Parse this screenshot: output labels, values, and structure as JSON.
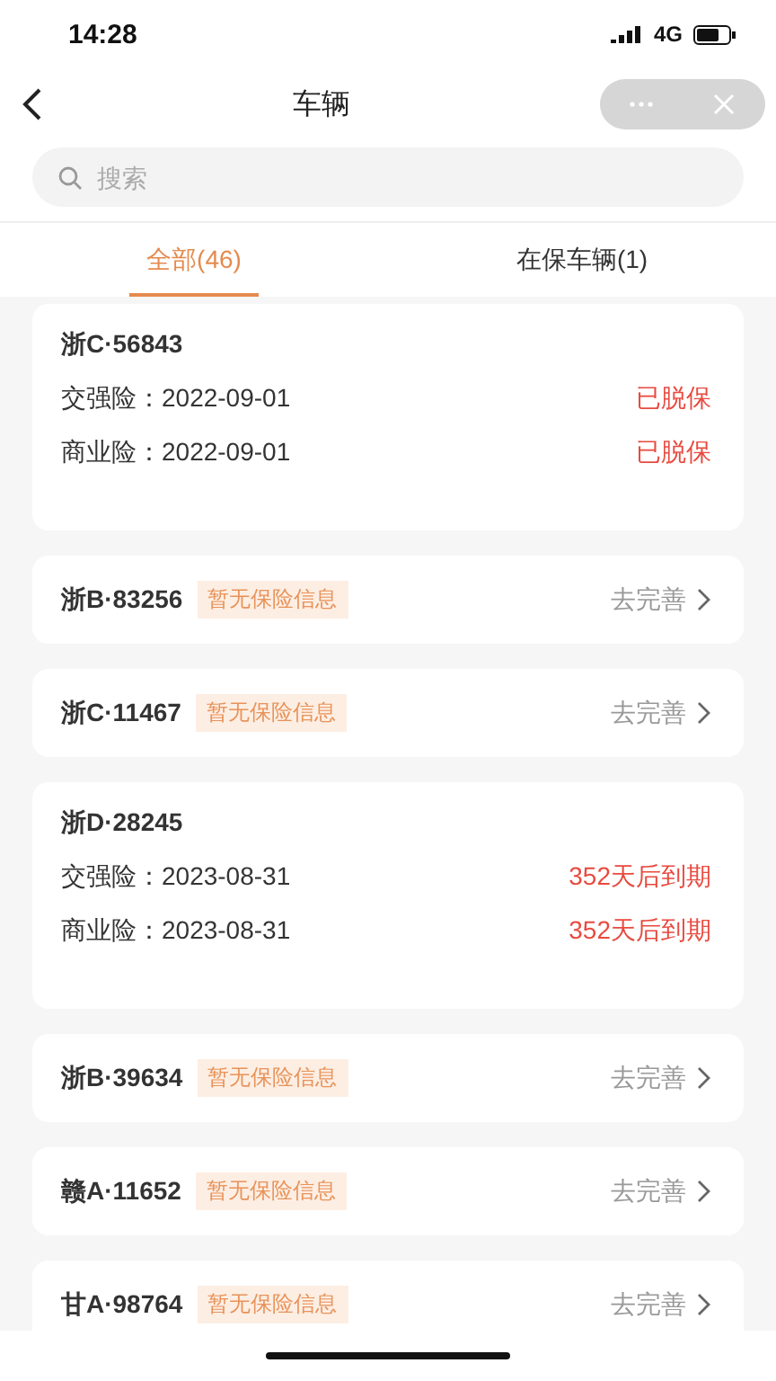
{
  "status_bar": {
    "time": "14:28",
    "network": "4G"
  },
  "nav": {
    "title": "车辆"
  },
  "search": {
    "placeholder": "搜索"
  },
  "tabs": [
    {
      "label": "全部(46)",
      "selected": true
    },
    {
      "label": "在保车辆(1)",
      "selected": false
    }
  ],
  "vehicles": [
    {
      "kind": "detail",
      "plate": "浙C·56843",
      "policies": [
        {
          "label": "交强险：2022-09-01",
          "status": "已脱保"
        },
        {
          "label": "商业险：2022-09-01",
          "status": "已脱保"
        }
      ]
    },
    {
      "kind": "simple",
      "plate": "浙B·83256",
      "tag": "暂无保险信息",
      "action": "去完善"
    },
    {
      "kind": "simple",
      "plate": "浙C·11467",
      "tag": "暂无保险信息",
      "action": "去完善"
    },
    {
      "kind": "detail",
      "plate": "浙D·28245",
      "policies": [
        {
          "label": "交强险：2023-08-31",
          "status": "352天后到期"
        },
        {
          "label": "商业险：2023-08-31",
          "status": "352天后到期"
        }
      ]
    },
    {
      "kind": "simple",
      "plate": "浙B·39634",
      "tag": "暂无保险信息",
      "action": "去完善"
    },
    {
      "kind": "simple",
      "plate": "赣A·11652",
      "tag": "暂无保险信息",
      "action": "去完善"
    },
    {
      "kind": "simple",
      "plate": "甘A·98764",
      "tag": "暂无保险信息",
      "action": "去完善"
    }
  ]
}
